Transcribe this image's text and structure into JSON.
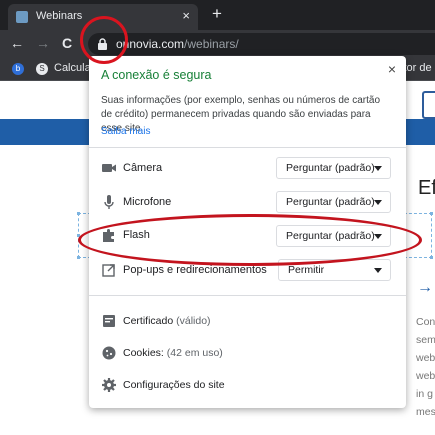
{
  "browser": {
    "tab": {
      "title": "Webinars",
      "close": "×"
    },
    "newtab": "+",
    "nav": {
      "back": "←",
      "forward": "→",
      "reload": "C"
    },
    "omnibox": {
      "url_host": "onnovia.com",
      "url_path": "/webinars/"
    },
    "bookmarks": [
      {
        "icon_letter": "b",
        "label": ""
      },
      {
        "icon_letter": "S",
        "label": "Calcula"
      }
    ],
    "bookmark_right": "ctor de"
  },
  "page": {
    "heading": "Ef",
    "arrow": "→",
    "paragraph_lines": [
      "Con",
      "sem",
      "web",
      "web",
      "in g",
      "mes"
    ]
  },
  "popup": {
    "title": "A conexão é segura",
    "close": "×",
    "description": "Suas informações (por exemplo, senhas ou números de cartão de crédito) permanecem privadas quando são enviadas para esse site.",
    "learn_more": "Saiba mais",
    "permissions": [
      {
        "icon": "camera-icon",
        "label": "Câmera",
        "value": "Perguntar (padrão)"
      },
      {
        "icon": "microphone-icon",
        "label": "Microfone",
        "value": "Perguntar (padrão)"
      },
      {
        "icon": "puzzle-icon",
        "label": "Flash",
        "value": "Perguntar (padrão)"
      },
      {
        "icon": "popup-icon",
        "label": "Pop-ups e redirecionamentos",
        "value": "Permitir"
      }
    ],
    "certificate": {
      "label": "Certificado",
      "status": "(válido)"
    },
    "cookies": {
      "label": "Cookies:",
      "count": "(42 em uso)"
    },
    "site_settings": "Configurações do site"
  },
  "colors": {
    "secure_green": "#188038",
    "link_blue": "#1a73e8",
    "annotation_red": "#d9141f",
    "page_blue": "#1f5ea7"
  }
}
